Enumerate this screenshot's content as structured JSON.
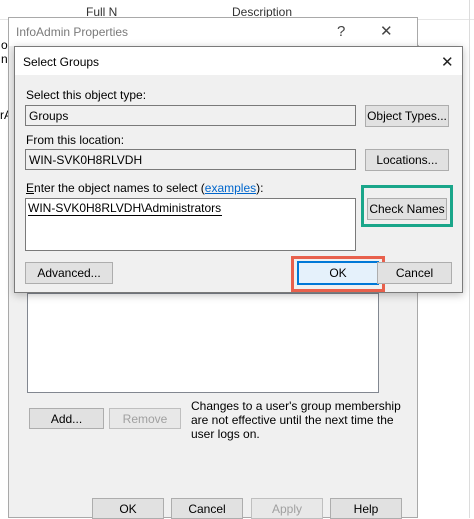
{
  "background_window": {
    "top_header_partial": [
      "Full N",
      "Description"
    ],
    "left_edge_fragments": [
      "o",
      "n",
      "rA"
    ],
    "right_edge_fragments": [
      "..."
    ]
  },
  "properties_window": {
    "title": "InfoAdmin Properties",
    "help_glyph": "?",
    "close_glyph": "✕",
    "add_label": "Add...",
    "remove_label": "Remove",
    "note_lines": [
      "Changes to a user's group membership",
      "are not effective until the next time the",
      "user logs on."
    ],
    "footer": {
      "ok_label": "OK",
      "cancel_label": "Cancel",
      "apply_label": "Apply",
      "help_label": "Help"
    }
  },
  "dialog": {
    "title": "Select Groups",
    "close_glyph": "✕",
    "object_type_label": "Select this object type:",
    "object_type_value": "Groups",
    "object_types_button": "Object Types...",
    "location_label": "From this location:",
    "location_value": "WIN-SVK0H8RLVDH",
    "locations_button": "Locations...",
    "names_label_prefix": "nter the object names to select (",
    "names_label_underlined": "E",
    "names_label_link": "examples",
    "names_label_suffix": "):",
    "names_value": "WIN-SVK0H8RLVDH\\Administrators",
    "check_names_button": "Check Names",
    "advanced_button": "Advanced...",
    "ok_button": "OK",
    "cancel_button": "Cancel"
  },
  "highlight_colors": {
    "check_names_outline": "#1aa68a",
    "ok_outline": "#e8604c",
    "link": "#0066cc"
  }
}
